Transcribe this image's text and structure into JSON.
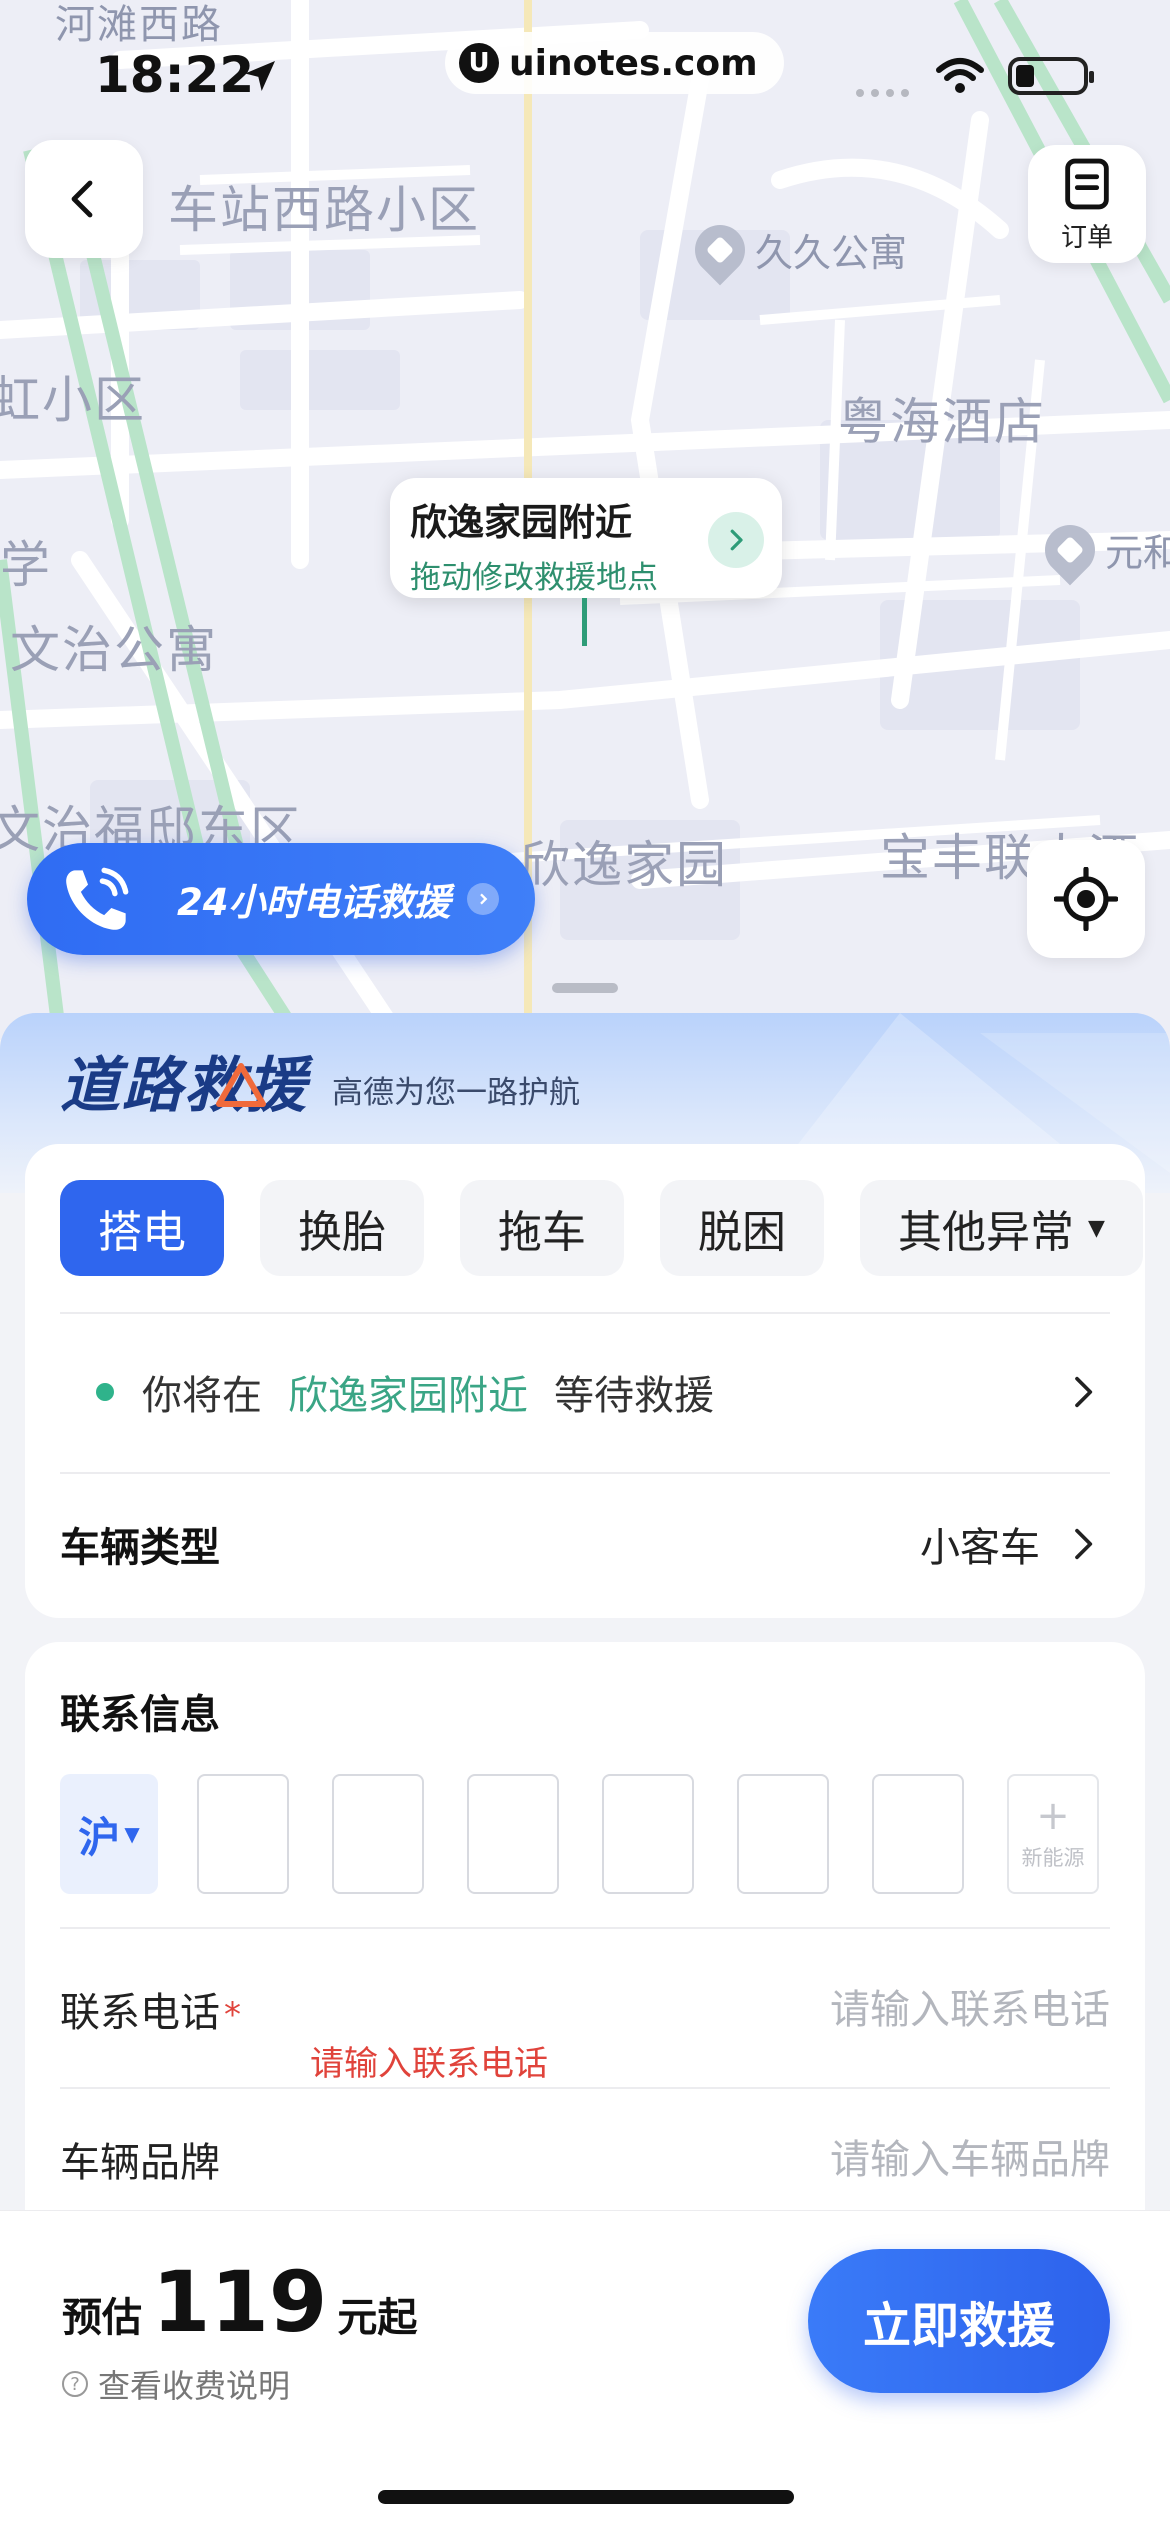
{
  "status_bar": {
    "time": "18:22",
    "watermark": "uinotes.com"
  },
  "map": {
    "labels": {
      "hetan_road": "河滩西路",
      "chezhan_community": "车站西路小区",
      "hong_community": "虹小区",
      "xue": "学",
      "wenzhi_apartment": "文治公寓",
      "wenzhi_east": "文治福邸东区",
      "xinyi_jiayuan": "欣逸家园",
      "baofeng": "宝丰联大酒",
      "yuehai_hotel": "粤海酒店"
    },
    "pois": {
      "jiujiu": "久久公寓",
      "yuanhe": "元和"
    },
    "order_label": "订单",
    "location_bubble": {
      "title": "欣逸家园附近",
      "subtitle": "拖动修改救援地点"
    },
    "call_banner": "24小时电话救援"
  },
  "sheet": {
    "brand_title": "道路救援",
    "brand_slogan": "高德为您一路护航",
    "tabs": [
      {
        "label": "搭电"
      },
      {
        "label": "换胎"
      },
      {
        "label": "拖车"
      },
      {
        "label": "脱困"
      },
      {
        "label": "其他异常"
      }
    ],
    "wait": {
      "prefix": "你将在",
      "place": "欣逸家园附近",
      "suffix": "等待救援"
    },
    "vehicle_type": {
      "label": "车辆类型",
      "value": "小客车"
    }
  },
  "contact": {
    "title": "联系信息",
    "plate_province": "沪",
    "new_energy": "新能源",
    "phone": {
      "label": "联系电话",
      "required_mark": "*",
      "placeholder": "请输入联系电话",
      "error": "请输入联系电话"
    },
    "brand": {
      "label": "车辆品牌",
      "placeholder": "请输入车辆品牌"
    }
  },
  "bottom": {
    "est_prefix": "预估",
    "price": "119",
    "est_suffix": "元起",
    "fee_link": "查看收费说明",
    "cta": "立即救援"
  },
  "colors": {
    "accent": "#2f66ee",
    "green": "#3aa585",
    "error": "#e0433b"
  }
}
